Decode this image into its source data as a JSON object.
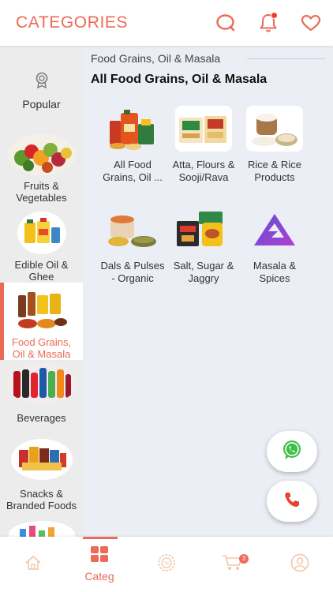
{
  "header": {
    "title": "CATEGORIES",
    "icons": [
      "search-icon",
      "bell-icon",
      "heart-icon"
    ]
  },
  "colors": {
    "accent": "#ec6a57",
    "sidebar_bg": "#ececec",
    "main_bg": "#ebeef4",
    "whatsapp": "#3fbf4a"
  },
  "sidebar": {
    "items": [
      {
        "label": "Popular",
        "icon": "badge-icon"
      },
      {
        "label": "Fruits &\nVegetables"
      },
      {
        "label": "Edible Oil &\nGhee"
      },
      {
        "label": "Food Grains,\nOil & Masala",
        "active": true
      },
      {
        "label": "Beverages"
      },
      {
        "label": "Snacks &\nBranded Foods"
      }
    ]
  },
  "main": {
    "breadcrumb": "Food Grains, Oil & Masala",
    "title": "All Food Grains, Oil & Masala",
    "tiles": [
      {
        "label": "All Food\nGrains, Oil ..."
      },
      {
        "label": "Atta, Flours &\nSooji/Rava"
      },
      {
        "label": "Rice & Rice\nProducts"
      },
      {
        "label": "Dals & Pulses\n- Organic"
      },
      {
        "label": "Salt, Sugar &\nJaggry"
      },
      {
        "label": "Masala &\nSpices"
      }
    ]
  },
  "bottom_nav": {
    "items": [
      {
        "icon": "home-icon"
      },
      {
        "icon": "categories-icon",
        "label": "Categ",
        "active": true
      },
      {
        "icon": "offers-icon"
      },
      {
        "icon": "cart-icon",
        "badge": "3"
      },
      {
        "icon": "profile-icon"
      }
    ]
  }
}
